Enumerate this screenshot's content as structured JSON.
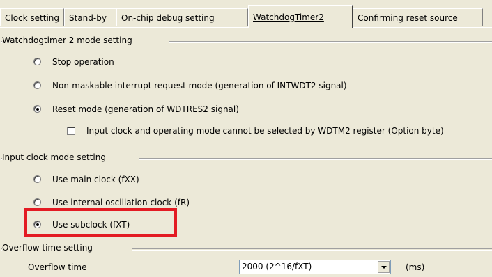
{
  "tabs": [
    {
      "label": "Clock setting"
    },
    {
      "label": "Stand-by"
    },
    {
      "label": "On-chip debug setting"
    },
    {
      "label": "WatchdogTimer2"
    },
    {
      "label": "Confirming reset source"
    }
  ],
  "active_tab": "WatchdogTimer2",
  "wdt_mode": {
    "title": "Watchdogtimer 2 mode setting",
    "options": [
      {
        "label": "Stop operation",
        "selected": false
      },
      {
        "label": "Non-maskable interrupt request mode (generation of INTWDT2 signal)",
        "selected": false
      },
      {
        "label": "Reset mode (generation of WDTRES2 signal)",
        "selected": true
      }
    ],
    "option_byte_checkbox": {
      "label": "Input clock and operating mode cannot be selected by WDTM2 register (Option byte)",
      "checked": false
    }
  },
  "input_clock": {
    "title": "Input clock mode setting",
    "options": [
      {
        "label": "Use main clock (fXX)",
        "selected": false
      },
      {
        "label": "Use internal oscillation clock (fR)",
        "selected": false
      },
      {
        "label": "Use subclock (fXT)",
        "selected": true
      }
    ]
  },
  "overflow": {
    "title": "Overflow time setting",
    "label": "Overflow time",
    "value": "2000 (2^16/fXT)",
    "unit": "(ms)"
  },
  "highlight_color": "#e31b23"
}
